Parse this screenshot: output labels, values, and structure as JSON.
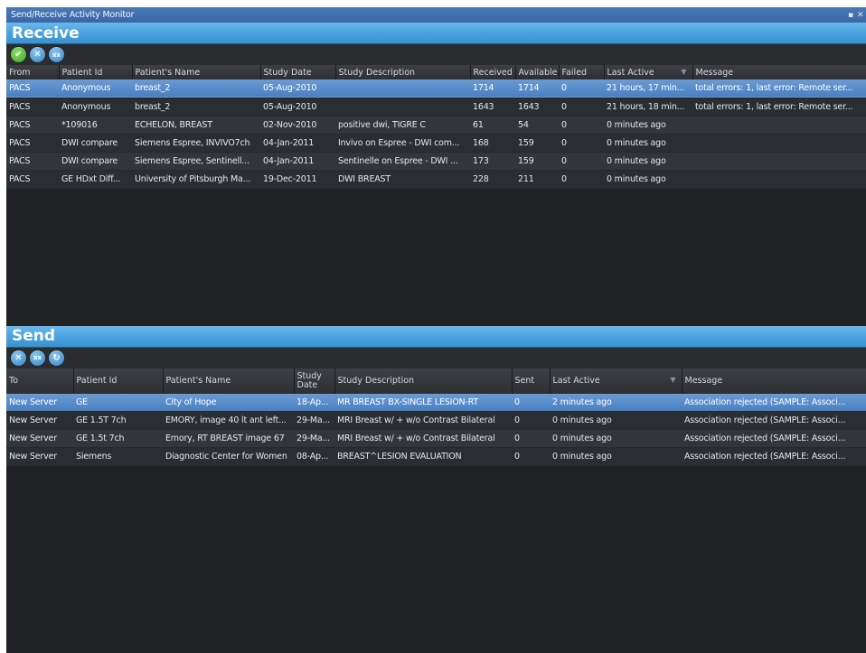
{
  "window": {
    "title": "Send/Receive Activity Monitor",
    "pin_icon": "pin-icon",
    "close_icon": "close-icon"
  },
  "receive": {
    "title": "Receive",
    "toolbar": [
      {
        "name": "accept-button",
        "icon": "check-icon",
        "glyph": "✔",
        "color": "green"
      },
      {
        "name": "cancel-button",
        "icon": "x-icon",
        "glyph": "✕",
        "color": "blue"
      },
      {
        "name": "cancel-all-button",
        "icon": "xx-icon",
        "glyph": "xx",
        "color": "blue"
      }
    ],
    "columns": [
      "From",
      "Patient Id",
      "Patient's Name",
      "Study Date",
      "Study Description",
      "Received",
      "Available",
      "Failed",
      "Last Active",
      "Message"
    ],
    "rows": [
      [
        "PACS",
        "Anonymous",
        "breast_2",
        "05-Aug-2010",
        "",
        "1714",
        "1714",
        "0",
        "21 hours, 17 min...",
        "total errors: 1, last error: Remote ser..."
      ],
      [
        "PACS",
        "Anonymous",
        "breast_2",
        "05-Aug-2010",
        "",
        "1643",
        "1643",
        "0",
        "21 hours, 18 min...",
        "total errors: 1, last error: Remote ser..."
      ],
      [
        "PACS",
        "*109016",
        "ECHELON, BREAST",
        "02-Nov-2010",
        "positive dwi, TIGRE C",
        "61",
        "54",
        "0",
        "0 minutes ago",
        ""
      ],
      [
        "PACS",
        "DWI compare",
        "Siemens Espree, INVIVO7ch",
        "04-Jan-2011",
        "Invivo on Espree - DWI com...",
        "168",
        "159",
        "0",
        "0 minutes ago",
        ""
      ],
      [
        "PACS",
        "DWI compare",
        "Siemens Espree, Sentinell...",
        "04-Jan-2011",
        "Sentinelle on Espree - DWI ...",
        "173",
        "159",
        "0",
        "0 minutes ago",
        ""
      ],
      [
        "PACS",
        "GE HDxt Diff...",
        "University of Pitsburgh Ma...",
        "19-Dec-2011",
        "DWI BREAST",
        "228",
        "211",
        "0",
        "0 minutes ago",
        ""
      ]
    ]
  },
  "send": {
    "title": "Send",
    "toolbar": [
      {
        "name": "cancel-button",
        "icon": "x-icon",
        "glyph": "✕",
        "color": "blue"
      },
      {
        "name": "cancel-all-button",
        "icon": "xx-icon",
        "glyph": "xx",
        "color": "blue"
      },
      {
        "name": "retry-button",
        "icon": "retry-icon",
        "glyph": "↻",
        "color": "blue"
      }
    ],
    "columns": [
      "To",
      "Patient Id",
      "Patient's Name",
      "Study Date",
      "Study Description",
      "Sent",
      "Last Active",
      "Message"
    ],
    "rows": [
      [
        "New Server",
        "GE",
        "City of Hope",
        "18-Ap...",
        "MR BREAST BX-SINGLE LESION-RT",
        "0",
        "2 minutes ago",
        "Association rejected (SAMPLE: Associ..."
      ],
      [
        "New Server",
        "GE 1.5T 7ch",
        "EMORY, image 40 lt ant left...",
        "29-Ma...",
        "MRI Breast w/ + w/o Contrast Bilateral",
        "0",
        "0 minutes ago",
        "Association rejected (SAMPLE: Associ..."
      ],
      [
        "New Server",
        "GE 1.5t 7ch",
        "Emory, RT BREAST image 67",
        "29-Ma...",
        "MRI Breast w/ + w/o Contrast Bilateral",
        "0",
        "0 minutes ago",
        "Association rejected (SAMPLE: Associ..."
      ],
      [
        "New Server",
        "Siemens",
        "Diagnostic Center for Women",
        "08-Ap...",
        "BREAST^LESION EVALUATION",
        "0",
        "0 minutes ago",
        "Association rejected (SAMPLE: Associ..."
      ]
    ]
  }
}
